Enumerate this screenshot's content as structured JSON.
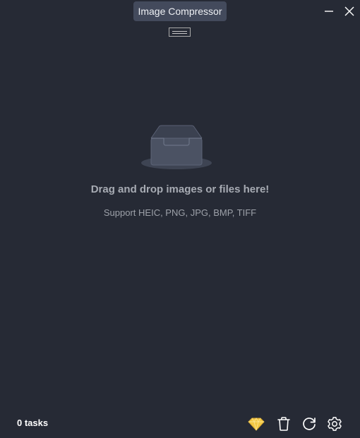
{
  "window": {
    "title": "Image Compressor"
  },
  "icons": {
    "minimize": "minimize-icon",
    "close": "close-icon",
    "drag_handle": "drag-handle-icon",
    "tray": "inbox-tray-icon",
    "premium": "diamond-icon",
    "trash": "trash-icon",
    "refresh": "refresh-icon",
    "settings": "gear-icon"
  },
  "colors": {
    "background": "#262a35",
    "title_pill": "#434a5c",
    "premium_gold": "#f2c744",
    "tray_fill": "#4b5263",
    "tray_shadow": "#3e4453"
  },
  "drop_zone": {
    "title": "Drag and drop images or files here!",
    "subtitle": "Support HEIC, PNG, JPG, BMP, TIFF"
  },
  "footer": {
    "task_count": "0 tasks"
  }
}
